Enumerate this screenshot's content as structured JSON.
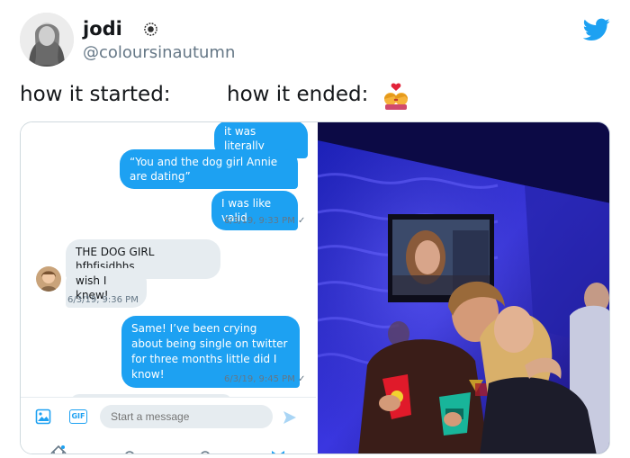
{
  "tweet": {
    "display_name": "jodi",
    "handle": "@coloursinautumn",
    "caption_left": "how it started:",
    "caption_right": "how it ended:",
    "verified_icon": "sunflower-badge-icon",
    "logo_icon": "twitter-bird-icon",
    "emoji_icon": "kissing-couple-emoji-icon"
  },
  "chat": {
    "messages": [
      {
        "text": "it was literally"
      },
      {
        "text": "“You and the dog girl Annie are dating”"
      },
      {
        "text": "I was like valid"
      },
      {
        "ts": "6/3/19, 9:33 PM ✓"
      },
      {
        "text": "THE DOG GIRL hfhfjsjdhhs"
      },
      {
        "text": "wish I knew!"
      },
      {
        "ts": "6/3/19, 9:36 PM"
      },
      {
        "text": "Same! I’ve been crying about being single on twitter for three months little did I know!"
      },
      {
        "ts": "6/3/19, 9:45 PM ✓"
      }
    ],
    "composer_placeholder": "Start a message",
    "gif_label": "GIF"
  },
  "colors": {
    "twitter_blue": "#1da1f2",
    "bubble_in": "#e6ecf0",
    "muted": "#657786"
  }
}
